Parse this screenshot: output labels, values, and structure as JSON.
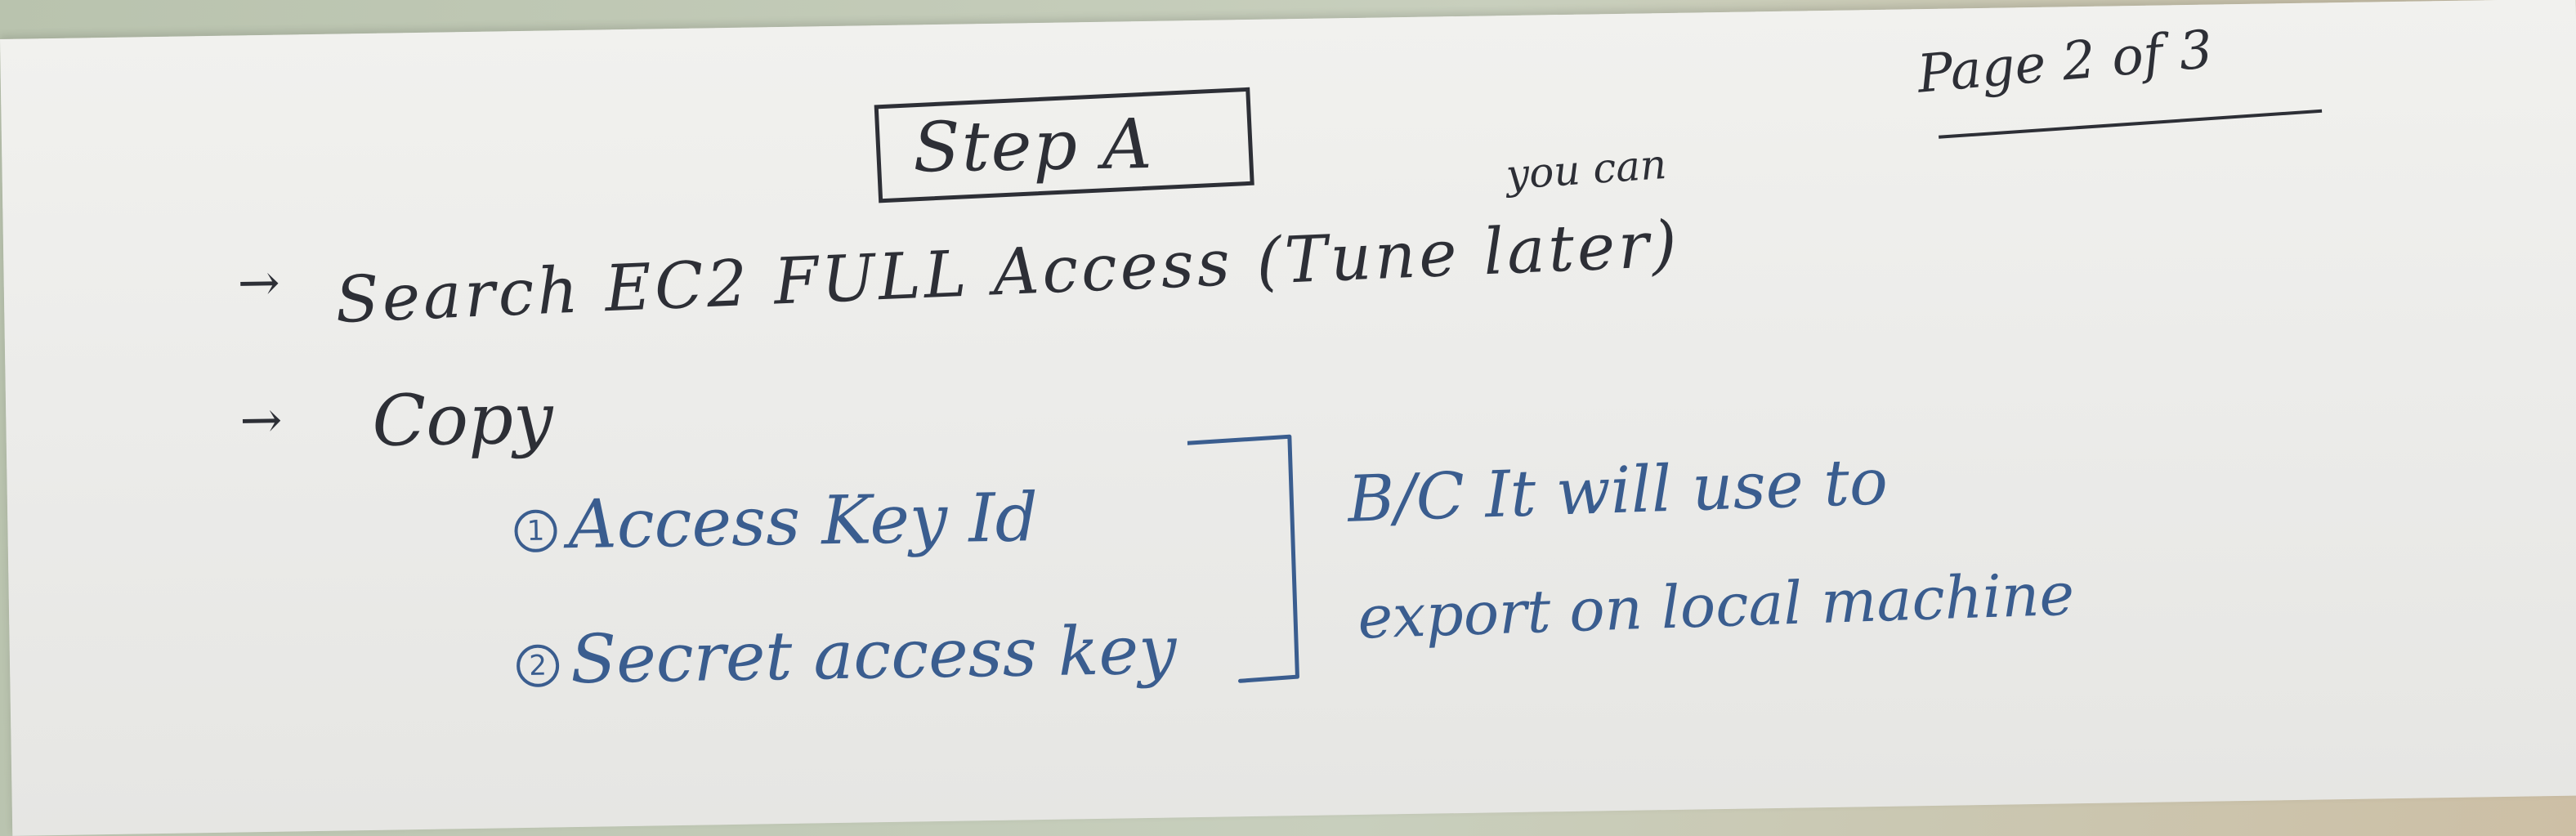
{
  "note": {
    "step_title": "Step A",
    "page_label": "Page 2 of 3",
    "annotation_above": "you can",
    "arrow_symbol": "→",
    "line_search": "Search EC2 FULL Access (Tune later)",
    "line_copy": "Copy",
    "items": [
      {
        "number": "1",
        "text": "Access Key Id"
      },
      {
        "number": "2",
        "text": "Secret access key"
      }
    ],
    "reason_line_1": "B/C It will use to",
    "reason_line_2": "export on local machine"
  },
  "colors": {
    "black_ink": "#2d2f36",
    "blue_ink": "#3a5d8f",
    "paper": "#ececea"
  }
}
